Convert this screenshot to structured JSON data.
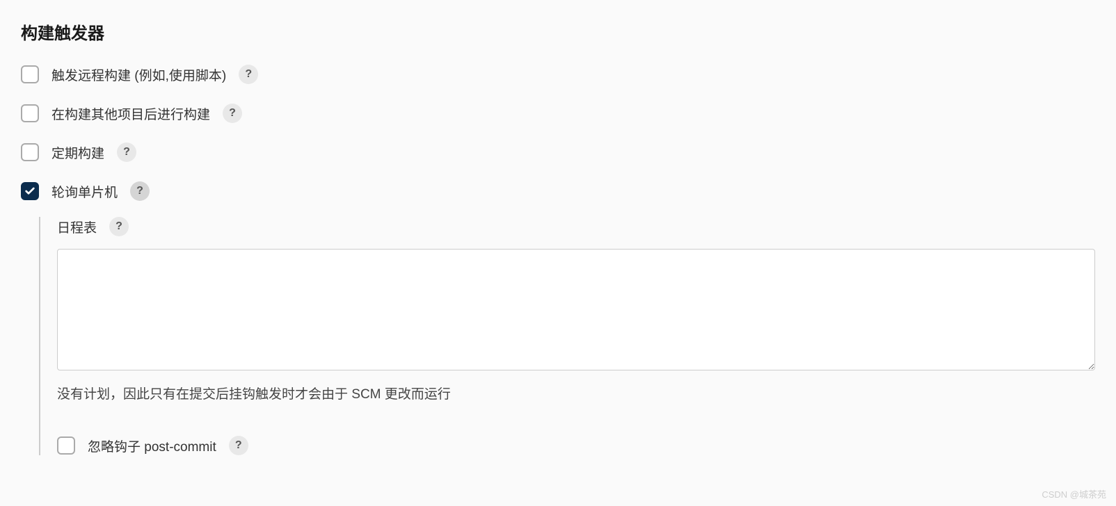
{
  "section": {
    "title": "构建触发器"
  },
  "triggers": {
    "remote": {
      "label": "触发远程构建 (例如,使用脚本)",
      "checked": false
    },
    "after_other": {
      "label": "在构建其他项目后进行构建",
      "checked": false
    },
    "periodic": {
      "label": "定期构建",
      "checked": false
    },
    "poll_scm": {
      "label": "轮询单片机",
      "checked": true
    }
  },
  "schedule": {
    "label": "日程表",
    "value": "",
    "hint": "没有计划，因此只有在提交后挂钩触发时才会由于 SCM 更改而运行"
  },
  "ignore_hook": {
    "label": "忽略钩子 post-commit",
    "checked": false
  },
  "watermark": "CSDN @城茶苑"
}
